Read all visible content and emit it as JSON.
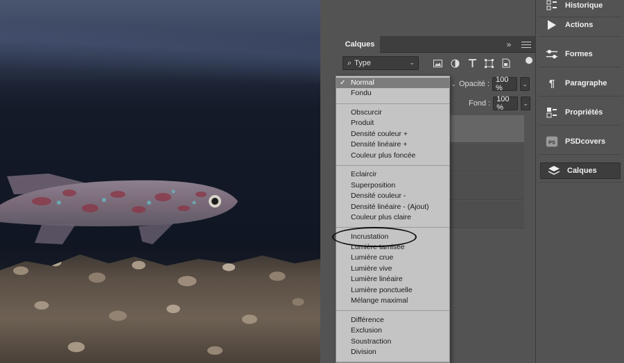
{
  "dock": {
    "items": [
      {
        "label": "Historique",
        "icon": "history-icon"
      },
      {
        "label": "Actions",
        "icon": "play-icon"
      },
      {
        "label": "Formes",
        "icon": "shapes-icon"
      },
      {
        "label": "Paragraphe",
        "icon": "paragraph-icon"
      },
      {
        "label": "Propriétés",
        "icon": "properties-icon"
      },
      {
        "label": "PSDcovers",
        "icon": "psdcovers-icon"
      },
      {
        "label": "Calques",
        "icon": "layers-icon"
      }
    ]
  },
  "layers_panel": {
    "tab_label": "Calques",
    "collapse_glyph": "»",
    "filter": {
      "value": "Type",
      "icon": "search-icon"
    },
    "filter_icons": [
      "image-filter-icon",
      "adjustment-filter-icon",
      "text-filter-icon",
      "shape-filter-icon",
      "smart-object-filter-icon"
    ],
    "opacity": {
      "label": "Opacité :",
      "value": "100 %"
    },
    "fill": {
      "label": "Fond :",
      "value": "100 %"
    }
  },
  "blend_menu": {
    "selected": "Normal",
    "groups": [
      [
        "Normal",
        "Fondu"
      ],
      [
        "Obscurcir",
        "Produit",
        "Densité couleur +",
        "Densité linéaire +",
        "Couleur plus foncée"
      ],
      [
        "Eclaircir",
        "Superposition",
        "Densité couleur -",
        "Densité linéaire - (Ajout)",
        "Couleur plus claire"
      ],
      [
        "Incrustation",
        "Lumière tamisée",
        "Lumière crue",
        "Lumière vive",
        "Lumière linéaire",
        "Lumière ponctuelle",
        "Mélange maximal"
      ],
      [
        "Différence",
        "Exclusion",
        "Soustraction",
        "Division"
      ]
    ],
    "highlighted": "Incrustation"
  },
  "colors": {
    "panel_bg": "#535353",
    "menu_bg": "#c4c4c4",
    "menu_selected": "#7c7c7c"
  }
}
